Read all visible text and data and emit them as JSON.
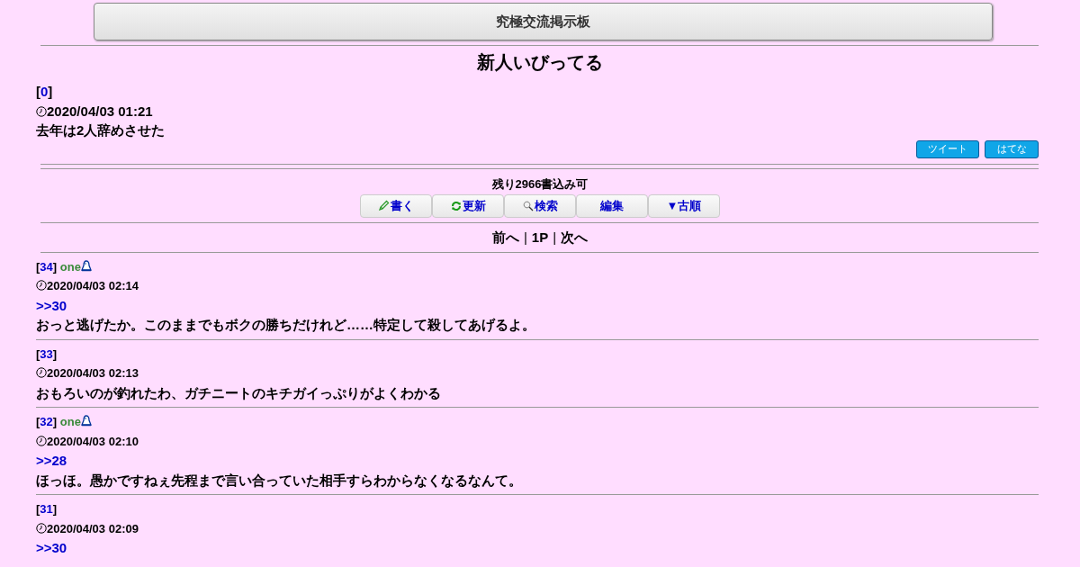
{
  "board_title": "究極交流掲示板",
  "thread_title": "新人いびってる",
  "first_post": {
    "number": {
      "open": "[",
      "value": "0",
      "close": "]"
    },
    "date": "2020/04/03 01:21",
    "body": "去年は2人辞めさせた"
  },
  "share_buttons": [
    "ツイート",
    "はてな"
  ],
  "remaining": "残り2966書込み可",
  "toolbar": [
    {
      "kind": "write",
      "label": "書く"
    },
    {
      "kind": "refresh",
      "label": "更新"
    },
    {
      "kind": "search",
      "label": "検索"
    },
    {
      "kind": "edit",
      "label": "編集"
    },
    {
      "kind": "order",
      "label": "▼古順"
    }
  ],
  "pager": [
    {
      "kind": "link",
      "text": "前へ"
    },
    {
      "kind": "sep",
      "text": "|"
    },
    {
      "kind": "link",
      "text": "1P"
    },
    {
      "kind": "sep",
      "text": "|"
    },
    {
      "kind": "link",
      "text": "次へ"
    }
  ],
  "posts": [
    {
      "number": {
        "open": "[",
        "value": "34",
        "close": "]"
      },
      "name": "one",
      "date": "2020/04/03 02:14",
      "reply_to": ">>30",
      "body": "おっと逃げたか。このままでもボクの勝ちだけれど……特定して殺してあげるよ。"
    },
    {
      "number": {
        "open": "[",
        "value": "33",
        "close": "]"
      },
      "date": "2020/04/03 02:13",
      "body": "おもろいのが釣れたわ、ガチニートのキチガイっぷりがよくわかる"
    },
    {
      "number": {
        "open": "[",
        "value": "32",
        "close": "]"
      },
      "name": "one",
      "date": "2020/04/03 02:10",
      "reply_to": ">>28",
      "body": "ほっほ。愚かですねぇ先程まで言い合っていた相手すらわからなくなるなんて。"
    },
    {
      "number": {
        "open": "[",
        "value": "31",
        "close": "]"
      },
      "date": "2020/04/03 02:09",
      "reply_to": ">>30"
    }
  ]
}
